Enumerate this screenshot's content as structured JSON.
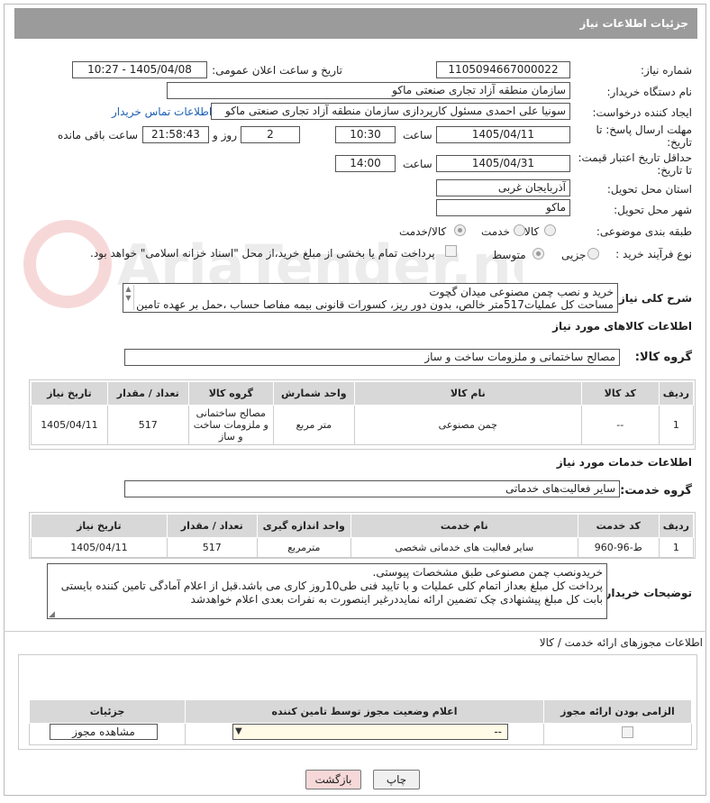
{
  "header": {
    "title": "جزئیات اطلاعات نیاز"
  },
  "fields": {
    "need_number_label": "شماره نیاز:",
    "need_number": "1105094667000022",
    "announce_label": "تاریخ و ساعت اعلان عمومی:",
    "announce_value": "1405/04/08 - 10:27",
    "buyer_org_label": "نام دستگاه خریدار:",
    "buyer_org": "سازمان منطقه آزاد تجاری   صنعتی ماکو",
    "creator_label": "ایجاد کننده درخواست:",
    "creator": "سونیا علی احمدی مسئول کارپردازی سازمان منطقه آزاد تجاری   صنعتی ماکو",
    "contact_link": "اطلاعات تماس خریدار",
    "reply_deadline_label": "مهلت ارسال پاسخ: تا تاریخ:",
    "reply_date": "1405/04/11",
    "time_label": "ساعت",
    "reply_time": "10:30",
    "days_value": "2",
    "days_label": "روز و",
    "remaining_time": "21:58:43",
    "remaining_label": "ساعت باقی مانده",
    "price_deadline_label": "حداقل تاریخ اعتبار قیمت: تا تاریخ:",
    "price_date": "1405/04/31",
    "price_time": "14:00",
    "province_label": "استان محل تحویل:",
    "province": "آذربایجان غربی",
    "city_label": "شهر محل تحویل:",
    "city": "ماکو",
    "category_label": "طبقه بندی موضوعی:",
    "category_options": [
      "کالا",
      "خدمت",
      "کالا/خدمت"
    ],
    "process_label": "نوع فرآیند خرید :",
    "process_options": [
      "جزیی",
      "متوسط"
    ],
    "payment_note": "پرداخت تمام یا بخشی از مبلغ خرید،از محل \"اسناد خزانه اسلامی\" خواهد بود.",
    "summary_label": "شرح کلی نیاز:",
    "summary_line1": "خرید و نصب چمن مصنوعی میدان گچوت",
    "summary_line2": "مساحت کل عملیات517متر خالص، بدون دور ریز، کسورات قانونی بیمه مفاصا حساب ،حمل بر عهده تامین"
  },
  "goods": {
    "section_title": "اطلاعات کالاهای مورد نیاز",
    "group_label": "گروه کالا:",
    "group_value": "مصالح ساختمانی و ملزومات ساخت و ساز",
    "columns": [
      "ردیف",
      "کد کالا",
      "نام کالا",
      "واحد شمارش",
      "گروه کالا",
      "تعداد / مقدار",
      "تاریخ نیاز"
    ],
    "rows": [
      {
        "row": "1",
        "code": "--",
        "name": "چمن مصنوعی",
        "unit": "متر مربع",
        "group": "مصالح ساختمانی و ملزومات ساخت و ساز",
        "qty": "517",
        "date": "1405/04/11"
      }
    ]
  },
  "services": {
    "section_title": "اطلاعات خدمات مورد نیاز",
    "group_label": "گروه خدمت:",
    "group_value": "سایر فعالیت‌های خدماتی",
    "columns": [
      "ردیف",
      "کد خدمت",
      "نام خدمت",
      "واحد اندازه گیری",
      "تعداد / مقدار",
      "تاریخ نیاز"
    ],
    "rows": [
      {
        "row": "1",
        "code": "ط-96-960",
        "name": "سایر فعالیت های خدماتی شخصی",
        "unit": "مترمربع",
        "qty": "517",
        "date": "1405/04/11"
      }
    ]
  },
  "buyer_notes": {
    "label": "توضیحات خریدار:",
    "line1": "خریدونصب چمن مصنوعی طبق مشخصات پیوستی.",
    "line2": "پرداخت کل مبلغ بعداز اتمام کلی عملیات و با تایید فنی طی10روز کاری می باشد.قبل از اعلام آمادگی تامین کننده بایستی",
    "line3": "بابت کل مبلغ پیشنهادی چک تضمین ارائه نمایددرغیر اینصورت به نفرات بعدی اعلام خواهدشد"
  },
  "permits": {
    "section_title": "اطلاعات مجوزهای ارائه خدمت / کالا",
    "columns": [
      "الزامی بودن ارائه مجوز",
      "اعلام وضعیت مجوز توسط تامین کننده",
      "جزئیات"
    ],
    "select_value": "--",
    "view_button": "مشاهده مجوز"
  },
  "footer": {
    "print_button": "چاپ",
    "back_button": "بازگشت"
  },
  "watermark_text": "AriaTender.neT"
}
